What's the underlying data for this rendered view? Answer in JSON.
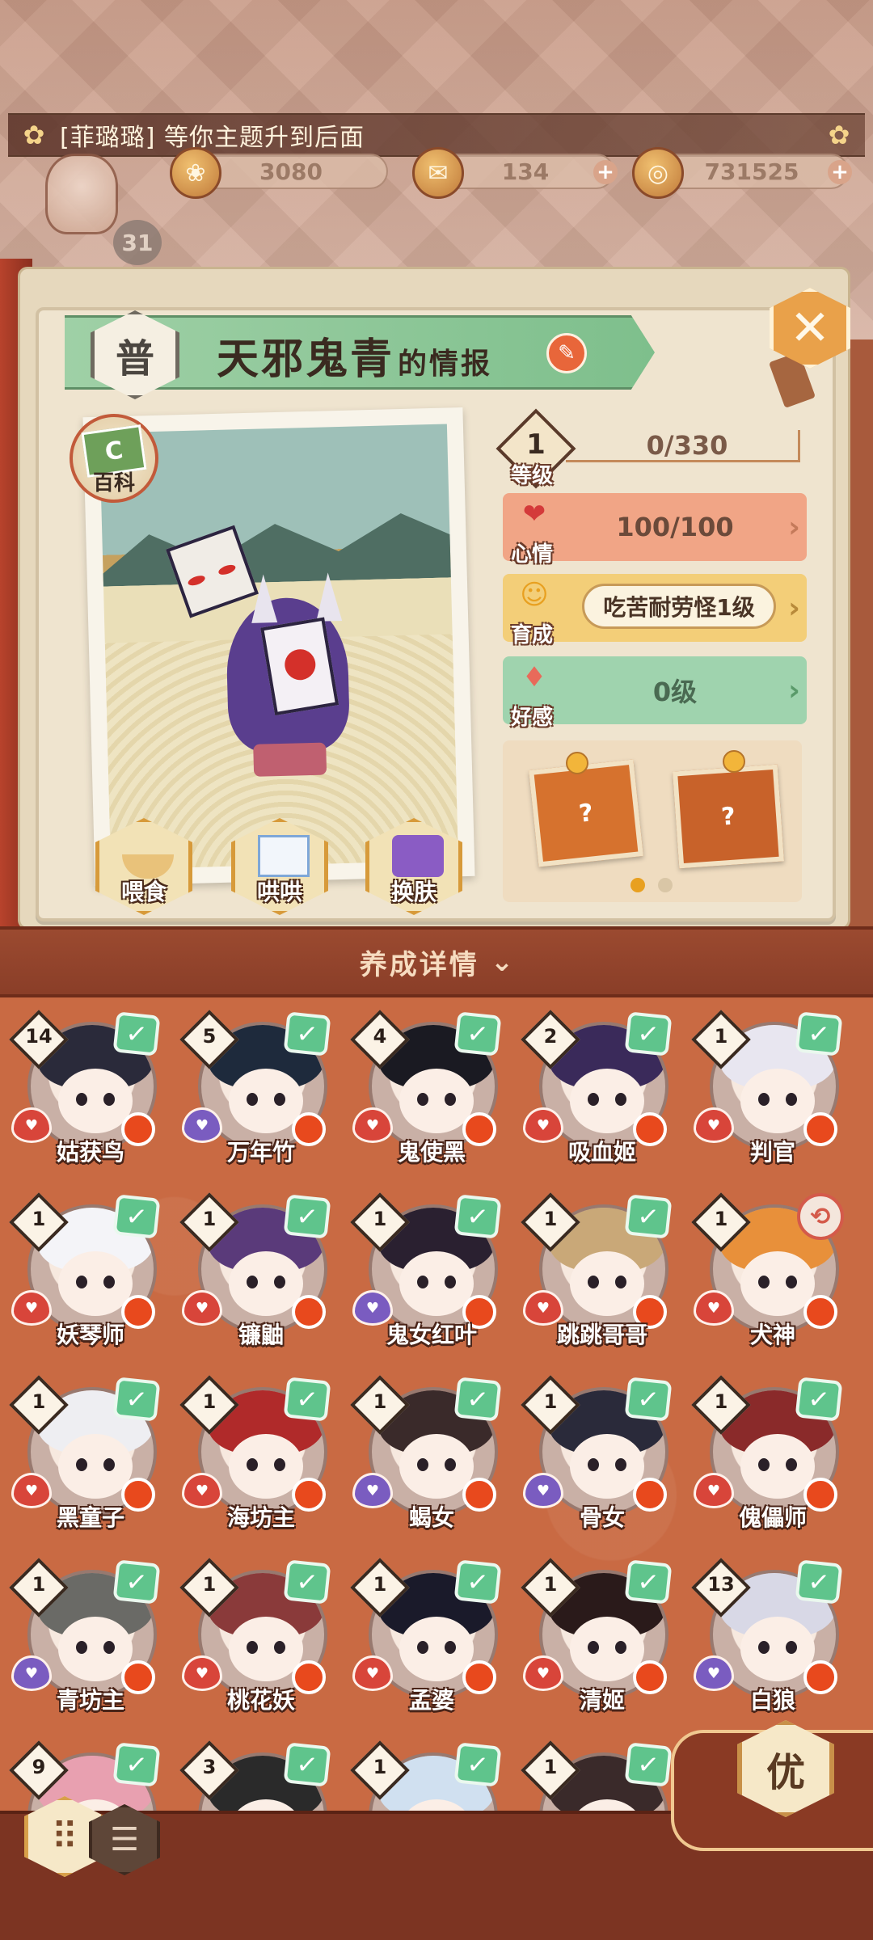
{
  "notice": {
    "text": "[菲璐璐] 等你主题升到后面"
  },
  "currency": {
    "gems": "3080",
    "tickets": "134",
    "coins": "731525"
  },
  "player": {
    "level": "31"
  },
  "info": {
    "rarity": "普",
    "name": "天邪鬼青",
    "name_suffix": "的情报",
    "wiki_label": "百科",
    "actions": [
      "喂食",
      "哄哄",
      "换肤"
    ]
  },
  "stats": {
    "level": {
      "label": "等级",
      "value": "1",
      "progress": "0/330"
    },
    "mood": {
      "label": "心情",
      "value": "100/100"
    },
    "training": {
      "label": "育成",
      "value": "吃苦耐劳怪1级"
    },
    "affection": {
      "label": "好感",
      "value": "0级"
    }
  },
  "gifts": {
    "symbol": "?"
  },
  "detail_banner": {
    "text": "养成详情",
    "chevron": "⌄"
  },
  "grid": {
    "cards": [
      {
        "name": "姑获鸟",
        "level": "14",
        "mood": "red"
      },
      {
        "name": "万年竹",
        "level": "5",
        "mood": "purple"
      },
      {
        "name": "鬼使黑",
        "level": "4",
        "mood": "red"
      },
      {
        "name": "吸血姬",
        "level": "2",
        "mood": "red"
      },
      {
        "name": "判官",
        "level": "1",
        "mood": "red"
      },
      {
        "name": "妖琴师",
        "level": "1",
        "mood": "red"
      },
      {
        "name": "镰鼬",
        "level": "1",
        "mood": "red"
      },
      {
        "name": "鬼女红叶",
        "level": "1",
        "mood": "purple"
      },
      {
        "name": "跳跳哥哥",
        "level": "1",
        "mood": "red"
      },
      {
        "name": "犬神",
        "level": "1",
        "mood": "red"
      },
      {
        "name": "黑童子",
        "level": "1",
        "mood": "red"
      },
      {
        "name": "海坊主",
        "level": "1",
        "mood": "red"
      },
      {
        "name": "蝎女",
        "level": "1",
        "mood": "purple"
      },
      {
        "name": "骨女",
        "level": "1",
        "mood": "purple"
      },
      {
        "name": "傀儡师",
        "level": "1",
        "mood": "red"
      },
      {
        "name": "青坊主",
        "level": "1",
        "mood": "purple"
      },
      {
        "name": "桃花妖",
        "level": "1",
        "mood": "red"
      },
      {
        "name": "孟婆",
        "level": "1",
        "mood": "red"
      },
      {
        "name": "清姬",
        "level": "1",
        "mood": "red"
      },
      {
        "name": "白狼",
        "level": "13",
        "mood": "purple"
      },
      {
        "name": "",
        "level": "9",
        "mood": "red"
      },
      {
        "name": "",
        "level": "3",
        "mood": "red"
      },
      {
        "name": "",
        "level": "1",
        "mood": "red"
      },
      {
        "name": "",
        "level": "1",
        "mood": "red"
      }
    ]
  },
  "bottom": {
    "optimize_label": "优"
  },
  "colors": {
    "accent": "#c96a43",
    "banner": "#8a3e28",
    "check": "#5fc48c",
    "alert": "#e8491d"
  }
}
